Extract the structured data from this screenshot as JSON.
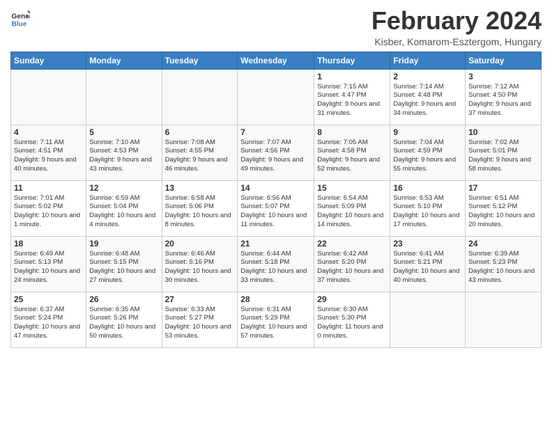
{
  "logo": {
    "line1": "General",
    "line2": "Blue"
  },
  "title": "February 2024",
  "location": "Kisber, Komarom-Esztergom, Hungary",
  "days_header": [
    "Sunday",
    "Monday",
    "Tuesday",
    "Wednesday",
    "Thursday",
    "Friday",
    "Saturday"
  ],
  "weeks": [
    [
      {
        "num": "",
        "info": ""
      },
      {
        "num": "",
        "info": ""
      },
      {
        "num": "",
        "info": ""
      },
      {
        "num": "",
        "info": ""
      },
      {
        "num": "1",
        "info": "Sunrise: 7:15 AM\nSunset: 4:47 PM\nDaylight: 9 hours\nand 31 minutes."
      },
      {
        "num": "2",
        "info": "Sunrise: 7:14 AM\nSunset: 4:48 PM\nDaylight: 9 hours\nand 34 minutes."
      },
      {
        "num": "3",
        "info": "Sunrise: 7:12 AM\nSunset: 4:50 PM\nDaylight: 9 hours\nand 37 minutes."
      }
    ],
    [
      {
        "num": "4",
        "info": "Sunrise: 7:11 AM\nSunset: 4:51 PM\nDaylight: 9 hours\nand 40 minutes."
      },
      {
        "num": "5",
        "info": "Sunrise: 7:10 AM\nSunset: 4:53 PM\nDaylight: 9 hours\nand 43 minutes."
      },
      {
        "num": "6",
        "info": "Sunrise: 7:08 AM\nSunset: 4:55 PM\nDaylight: 9 hours\nand 46 minutes."
      },
      {
        "num": "7",
        "info": "Sunrise: 7:07 AM\nSunset: 4:56 PM\nDaylight: 9 hours\nand 49 minutes."
      },
      {
        "num": "8",
        "info": "Sunrise: 7:05 AM\nSunset: 4:58 PM\nDaylight: 9 hours\nand 52 minutes."
      },
      {
        "num": "9",
        "info": "Sunrise: 7:04 AM\nSunset: 4:59 PM\nDaylight: 9 hours\nand 55 minutes."
      },
      {
        "num": "10",
        "info": "Sunrise: 7:02 AM\nSunset: 5:01 PM\nDaylight: 9 hours\nand 58 minutes."
      }
    ],
    [
      {
        "num": "11",
        "info": "Sunrise: 7:01 AM\nSunset: 5:02 PM\nDaylight: 10 hours\nand 1 minute."
      },
      {
        "num": "12",
        "info": "Sunrise: 6:59 AM\nSunset: 5:04 PM\nDaylight: 10 hours\nand 4 minutes."
      },
      {
        "num": "13",
        "info": "Sunrise: 6:58 AM\nSunset: 5:06 PM\nDaylight: 10 hours\nand 8 minutes."
      },
      {
        "num": "14",
        "info": "Sunrise: 6:56 AM\nSunset: 5:07 PM\nDaylight: 10 hours\nand 11 minutes."
      },
      {
        "num": "15",
        "info": "Sunrise: 6:54 AM\nSunset: 5:09 PM\nDaylight: 10 hours\nand 14 minutes."
      },
      {
        "num": "16",
        "info": "Sunrise: 6:53 AM\nSunset: 5:10 PM\nDaylight: 10 hours\nand 17 minutes."
      },
      {
        "num": "17",
        "info": "Sunrise: 6:51 AM\nSunset: 5:12 PM\nDaylight: 10 hours\nand 20 minutes."
      }
    ],
    [
      {
        "num": "18",
        "info": "Sunrise: 6:49 AM\nSunset: 5:13 PM\nDaylight: 10 hours\nand 24 minutes."
      },
      {
        "num": "19",
        "info": "Sunrise: 6:48 AM\nSunset: 5:15 PM\nDaylight: 10 hours\nand 27 minutes."
      },
      {
        "num": "20",
        "info": "Sunrise: 6:46 AM\nSunset: 5:16 PM\nDaylight: 10 hours\nand 30 minutes."
      },
      {
        "num": "21",
        "info": "Sunrise: 6:44 AM\nSunset: 5:18 PM\nDaylight: 10 hours\nand 33 minutes."
      },
      {
        "num": "22",
        "info": "Sunrise: 6:42 AM\nSunset: 5:20 PM\nDaylight: 10 hours\nand 37 minutes."
      },
      {
        "num": "23",
        "info": "Sunrise: 6:41 AM\nSunset: 5:21 PM\nDaylight: 10 hours\nand 40 minutes."
      },
      {
        "num": "24",
        "info": "Sunrise: 6:39 AM\nSunset: 5:23 PM\nDaylight: 10 hours\nand 43 minutes."
      }
    ],
    [
      {
        "num": "25",
        "info": "Sunrise: 6:37 AM\nSunset: 5:24 PM\nDaylight: 10 hours\nand 47 minutes."
      },
      {
        "num": "26",
        "info": "Sunrise: 6:35 AM\nSunset: 5:26 PM\nDaylight: 10 hours\nand 50 minutes."
      },
      {
        "num": "27",
        "info": "Sunrise: 6:33 AM\nSunset: 5:27 PM\nDaylight: 10 hours\nand 53 minutes."
      },
      {
        "num": "28",
        "info": "Sunrise: 6:31 AM\nSunset: 5:29 PM\nDaylight: 10 hours\nand 57 minutes."
      },
      {
        "num": "29",
        "info": "Sunrise: 6:30 AM\nSunset: 5:30 PM\nDaylight: 11 hours\nand 0 minutes."
      },
      {
        "num": "",
        "info": ""
      },
      {
        "num": "",
        "info": ""
      }
    ]
  ]
}
